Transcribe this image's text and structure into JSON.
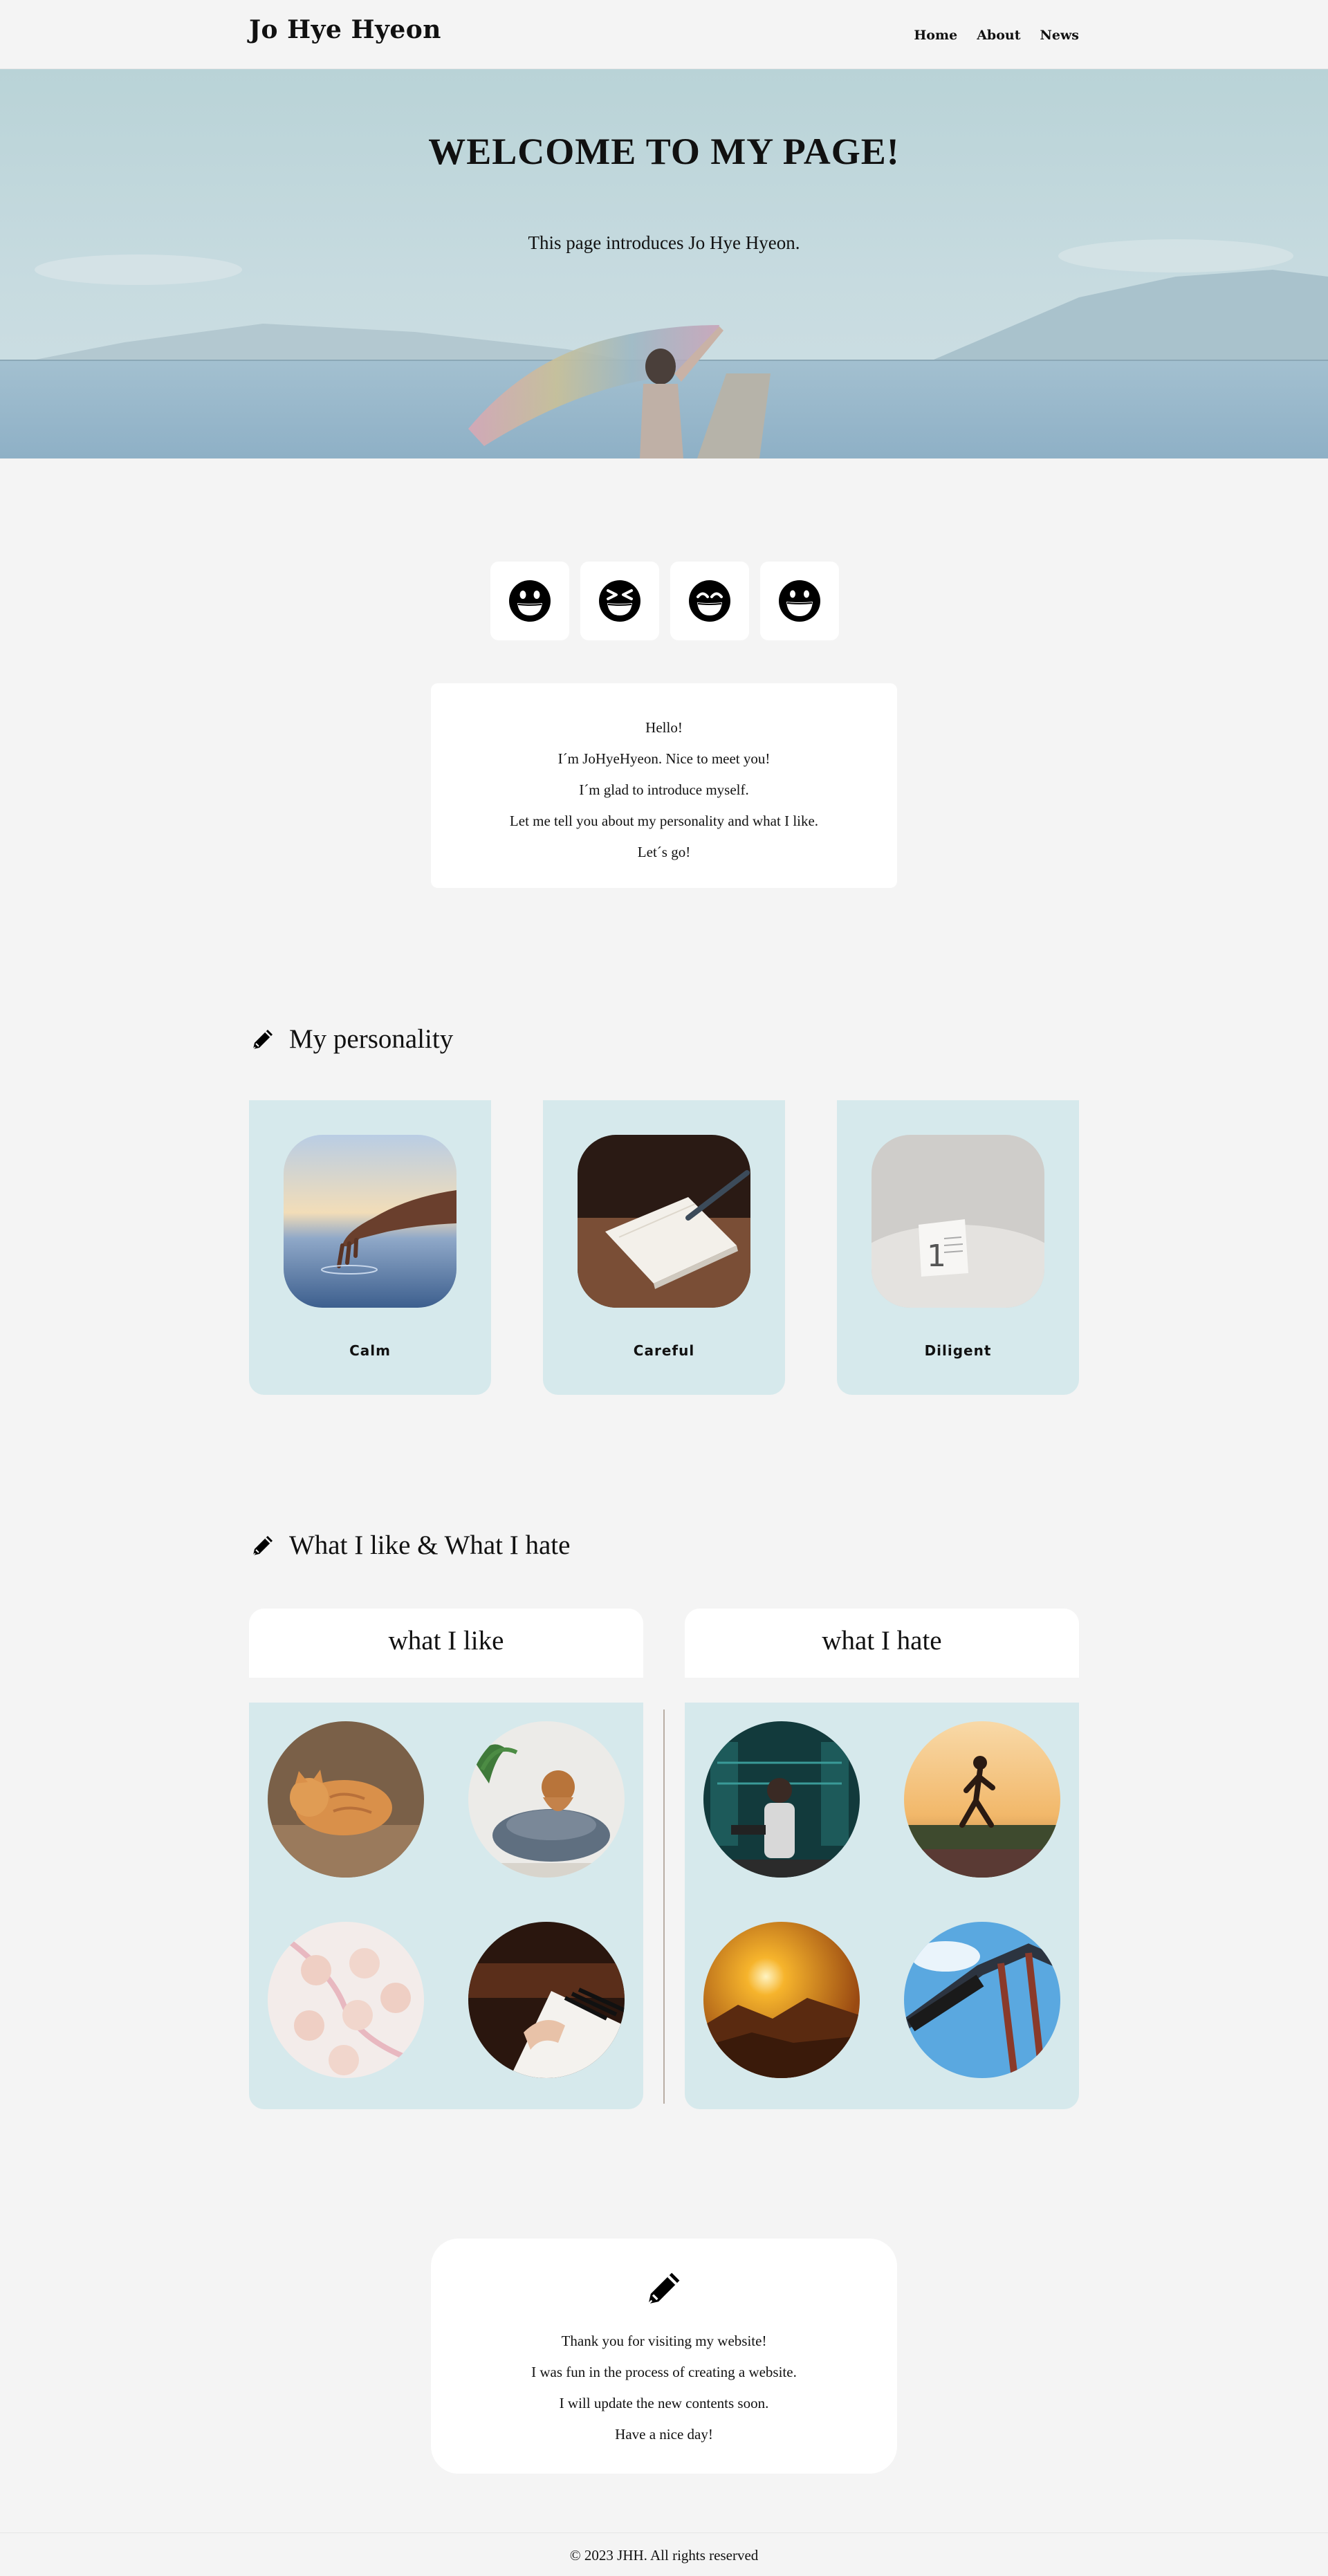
{
  "header": {
    "logo": "Jo Hye Hyeon",
    "nav": [
      "Home",
      "About",
      "News"
    ]
  },
  "hero": {
    "title": "WELCOME TO MY PAGE!",
    "subtitle": "This page introduces Jo Hye Hyeon."
  },
  "emojis": [
    "grinning-face-icon",
    "squinting-laugh-face-icon",
    "beaming-face-icon",
    "grinning-smile-face-icon"
  ],
  "intro": {
    "lines": [
      "Hello!",
      "I´m JoHyeHyeon. Nice to meet you!",
      "I´m glad to introduce myself.",
      "Let me tell you about my personality and what I like.",
      "Let´s go!"
    ]
  },
  "personality": {
    "heading": "My personality",
    "cards": [
      {
        "label": "Calm",
        "image": "hand-touching-water-photo"
      },
      {
        "label": "Careful",
        "image": "notebook-and-pen-photo"
      },
      {
        "label": "Diligent",
        "image": "desk-calendar-photo"
      }
    ]
  },
  "likes": {
    "heading": "What I like & What I hate",
    "like_title": "what I like",
    "hate_title": "what I hate",
    "like_images": [
      "orange-cat-photo",
      "dog-on-bed-photo",
      "macarons-photo",
      "piano-photo"
    ],
    "hate_images": [
      "gym-workout-photo",
      "jogging-photo",
      "sunrise-mountain-photo",
      "roller-coaster-photo"
    ]
  },
  "closing": {
    "icon": "pencil-icon",
    "lines": [
      "Thank you for visiting my website!",
      "I was fun in the process of creating a website.",
      "I will update the new contents soon.",
      "Have a nice day!"
    ]
  },
  "footer": {
    "copyright": "© 2023 JHH. All rights reserved"
  },
  "colors": {
    "background": "#f4f4f4",
    "card_blue": "#d6e9ec",
    "white": "#ffffff",
    "text": "#111111"
  }
}
